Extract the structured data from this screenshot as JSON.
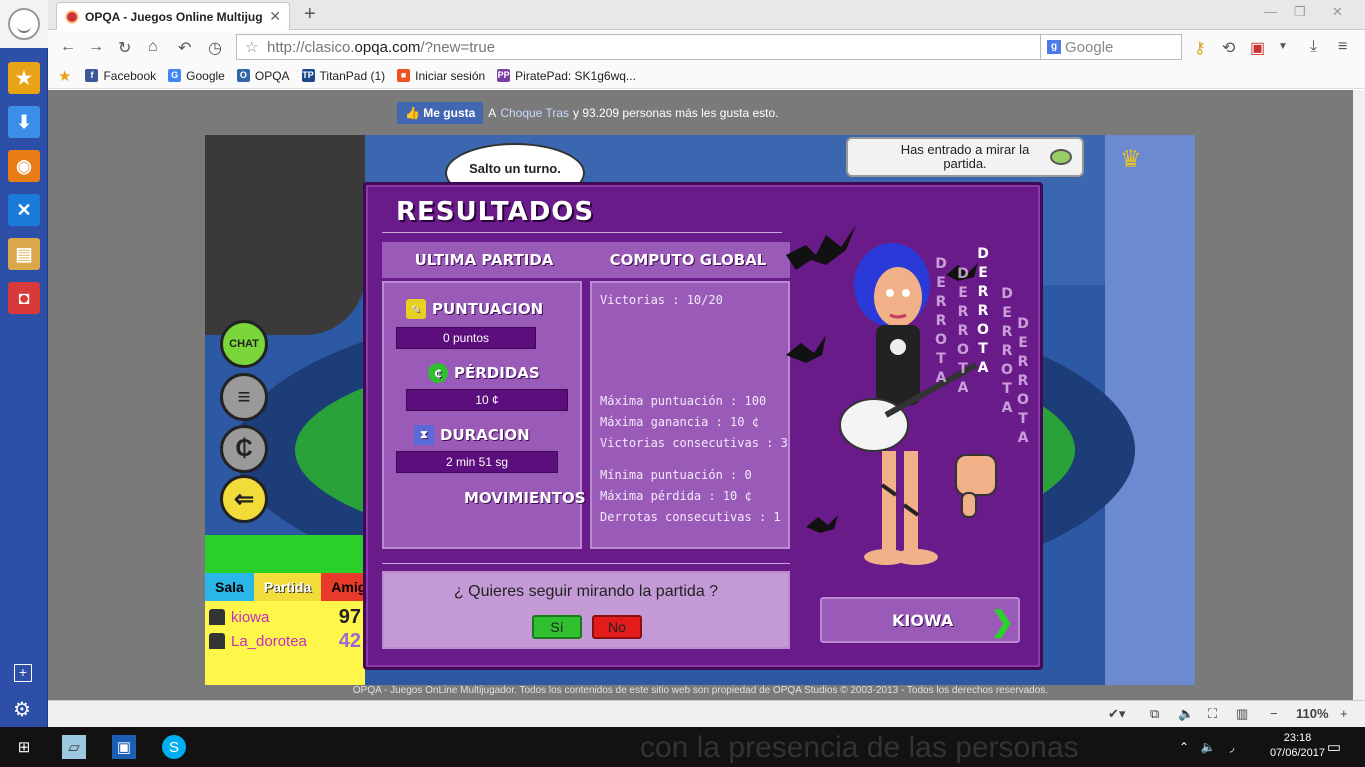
{
  "browser": {
    "tab_title": "OPQA - Juegos Online Multijuga...",
    "new_tab": "+",
    "url_prefix": "http://clasico.",
    "url_domain": "opqa.com",
    "url_suffix": "/?new=true",
    "search_placeholder": "Google",
    "search_engine_badge": "g",
    "bookmarks": [
      {
        "label": "Facebook",
        "icon": "facebook-icon",
        "color": "#3b5998",
        "glyph": "f"
      },
      {
        "label": "Google",
        "icon": "google-icon",
        "color": "#4285f4",
        "glyph": "G"
      },
      {
        "label": "OPQA",
        "icon": "opqa-icon",
        "color": "#3366aa",
        "glyph": "O"
      },
      {
        "label": "TitanPad (1)",
        "icon": "titanpad-icon",
        "color": "#1a4a8a",
        "glyph": "TP"
      },
      {
        "label": "Iniciar sesión",
        "icon": "microsoft-icon",
        "color": "#f25022",
        "glyph": "■"
      },
      {
        "label": "PiratePad: SK1g6wq...",
        "icon": "piratepad-icon",
        "color": "#7b3fa0",
        "glyph": "PP"
      }
    ]
  },
  "sidebar_colors": [
    "#e8a317",
    "#3a8ee8",
    "#e87d17",
    "#1a7ad8",
    "#d8a84a",
    "#d83a3a"
  ],
  "page": {
    "fb_like_label": "Me gusta",
    "fb_text_a": "A",
    "fb_friend": "Choque Tras",
    "fb_text_rest": "y 93.209 personas más les gusta esto.",
    "footer": "OPQA - Juegos OnLine Multijugador. Todos los contenidos de este sitio web son propiedad de OPQA Studios © 2003-2013 - Todos los derechos reservados."
  },
  "game": {
    "speech_bubble": "Salto un turno.",
    "watch_notice": "Has entrado a mirar la partida.",
    "side_buttons": [
      {
        "name": "chat-button",
        "label": "CHAT",
        "color": "#7ad63a"
      },
      {
        "name": "scoreboard-button",
        "label": "≡",
        "color": "#9a9a9a"
      },
      {
        "name": "credits-button",
        "label": "₵",
        "color": "#9a9a9a"
      },
      {
        "name": "exit-button",
        "label": "⇐",
        "color": "#f2dc3a"
      }
    ],
    "player_tabs": [
      {
        "label": "Sala",
        "bg": "#2ab7e8"
      },
      {
        "label": "Partida",
        "bg": "#f2dc3a"
      },
      {
        "label": "Amig",
        "bg": "#e83a2a"
      }
    ],
    "players": [
      {
        "name": "kiowa",
        "score": "97"
      },
      {
        "name": "La_dorotea",
        "score": "42"
      }
    ]
  },
  "results": {
    "title": "RESULTADOS",
    "col_last": "ULTIMA PARTIDA",
    "col_global": "COMPUTO GLOBAL",
    "score_label": "PUNTUACION",
    "score_value": "0 puntos",
    "losses_label": "PÉRDIDAS",
    "losses_value": "10 ¢",
    "duration_label": "DURACION",
    "duration_value": "2 min 51 sg",
    "moves_label": "MOVIMIENTOS",
    "global": {
      "victories": "Victorias : 10/20",
      "max_score": "Máxima puntuación : 100",
      "max_gain": "Máxima ganancia : 10 ¢",
      "consec_wins": "Victorias consecutivas : 3",
      "min_score": "Mínima puntuación : 0",
      "max_loss": "Máxima pérdida : 10 ¢",
      "consec_losses": "Derrotas consecutivas : 1"
    },
    "question": "¿ Quieres seguir mirando la partida ?",
    "yes": "Sí",
    "no": "No",
    "next_player": "KIOWA",
    "stamp_word": "DERROTA"
  },
  "status": {
    "zoom": "110%"
  },
  "taskbar": {
    "bg_text": "con la presencia de las personas",
    "time": "23:18",
    "date": "07/06/2017"
  }
}
